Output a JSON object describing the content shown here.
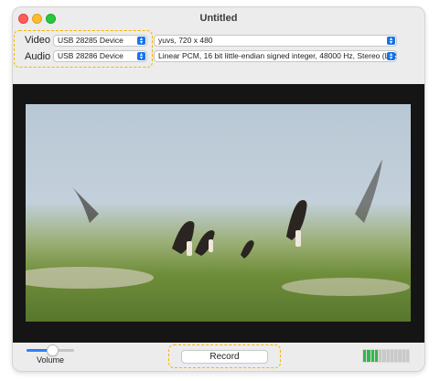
{
  "window": {
    "title": "Untitled"
  },
  "video": {
    "label": "Video",
    "device": "USB 28285 Device",
    "format": "yuvs, 720 x 480"
  },
  "audio": {
    "label": "Audio",
    "device": "USB 28286 Device",
    "format": "Linear PCM, 16 bit little-endian signed integer, 48000 Hz, Stereo (L R)"
  },
  "controls": {
    "volume_label": "Volume",
    "volume_level": 0.55,
    "record_label": "Record",
    "level_meter_active_fraction": 0.33
  },
  "colors": {
    "highlight": "#f4b400",
    "accent": "#2d7ff9",
    "meter_on": "#2fb84a"
  }
}
